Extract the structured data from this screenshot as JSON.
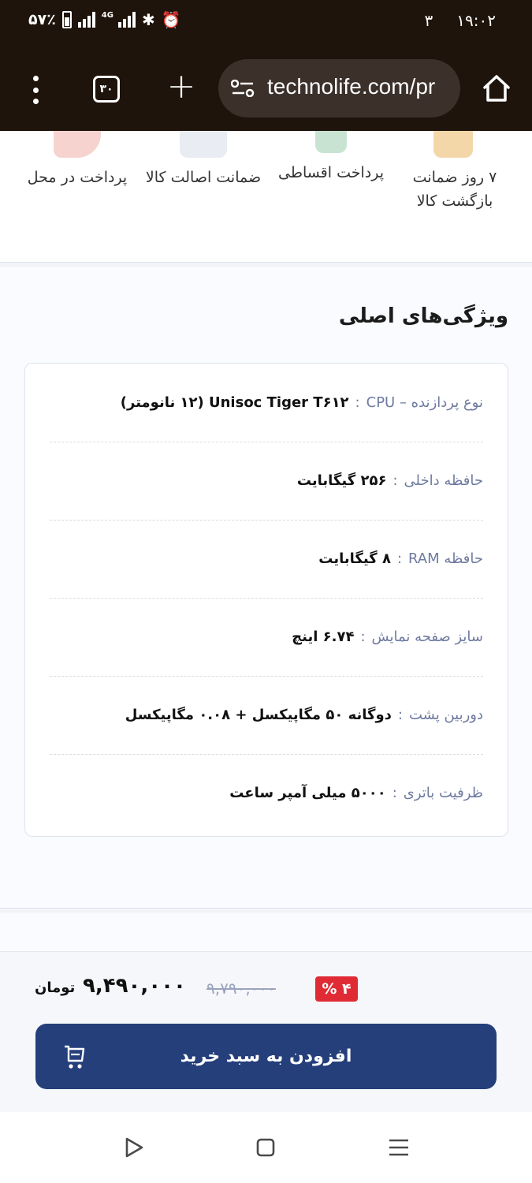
{
  "status_bar": {
    "battery_percent": "۵۷٪",
    "network_type": "4G",
    "notification_count": "۳",
    "time": "۱۹:۰۲"
  },
  "browser": {
    "tab_count": "۳۰",
    "url": "technolife.com/pr"
  },
  "features": [
    {
      "label_line1": "۷ روز ضمانت",
      "label_line2": "بازگشت کالا",
      "icon": "return-box-icon"
    },
    {
      "label_line1": "پرداخت اقساطی",
      "label_line2": "",
      "icon": "installment-icon"
    },
    {
      "label_line1": "ضمانت اصالت کالا",
      "label_line2": "",
      "icon": "authenticity-badge-icon"
    },
    {
      "label_line1": "پرداخت در محل",
      "label_line2": "",
      "icon": "pay-on-delivery-icon"
    }
  ],
  "specs": {
    "title": "ویژگی‌های اصلی",
    "separator": ":",
    "rows": [
      {
        "label": "نوع پردازنده – CPU",
        "value": "Unisoc Tiger T۶۱۲ (۱۲ نانومتر)"
      },
      {
        "label": "حافظه داخلی",
        "value": "۲۵۶ گیگابایت"
      },
      {
        "label": "حافظه RAM",
        "value": "۸ گیگابایت"
      },
      {
        "label": "سایز صفحه نمایش",
        "value": "۶.۷۴ اینچ"
      },
      {
        "label": "دوربین پشت",
        "value": "دوگانه ۵۰ مگاپیکسل + ۰.۰۸ مگاپیکسل"
      },
      {
        "label": "ظرفیت باتری",
        "value": "۵۰۰۰ میلی آمپر ساعت"
      }
    ]
  },
  "purchase": {
    "discount": "۴ %",
    "old_price": "۹,۷۹۰,۰۰۰",
    "new_price": "۹,۴۹۰,۰۰۰",
    "currency": "تومان",
    "add_to_cart_label": "افزودن به سبد خرید"
  },
  "colors": {
    "chrome_bg": "#1e140b",
    "accent_blue": "#253f7b",
    "discount_red": "#e02b35",
    "label_gray_blue": "#6e7aa0"
  }
}
